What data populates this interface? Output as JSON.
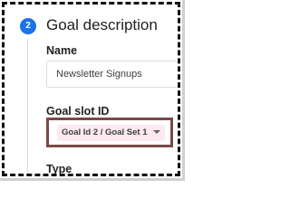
{
  "step": {
    "number": "2",
    "title": "Goal description"
  },
  "name_field": {
    "label": "Name",
    "value": "Newsletter Signups"
  },
  "goal_slot": {
    "label": "Goal slot ID",
    "selected": "Goal Id 2 / Goal Set 1"
  },
  "type_field": {
    "label": "Type"
  },
  "colors": {
    "step_badge": "#1a73e8",
    "highlight_border": "#7a4a45",
    "select_background": "#fde9ef"
  }
}
